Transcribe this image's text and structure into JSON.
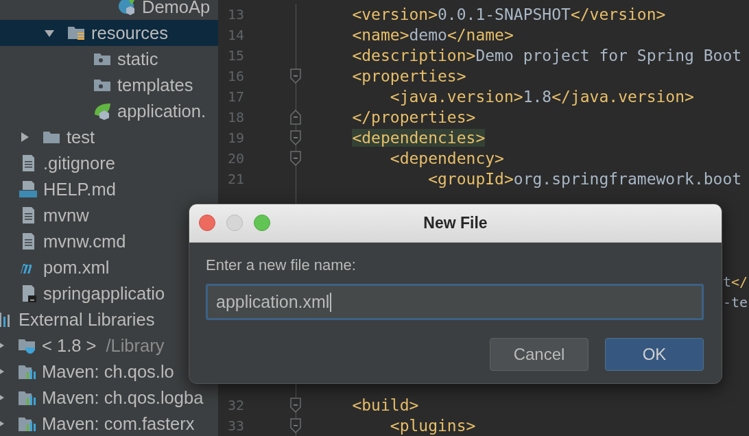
{
  "sidebar": {
    "tree": [
      {
        "children": [
          {
            "children": [
              {
                "children": [
                  {
                    "children": [
                      {
                        "children": [
                          {
                            "label": "DemoAp",
                            "kind": "spring-class",
                            "selected": false
                          }
                        ]
                      }
                    ]
                  },
                  {
                    "label": "resources",
                    "kind": "resources-folder",
                    "expanded": true,
                    "selected": true,
                    "children": [
                      {
                        "label": "static",
                        "kind": "web-folder",
                        "selected": false
                      },
                      {
                        "label": "templates",
                        "kind": "web-folder",
                        "selected": false
                      },
                      {
                        "label": "application.",
                        "kind": "spring-config",
                        "selected": false
                      }
                    ]
                  }
                ]
              },
              {
                "label": "test",
                "kind": "folder",
                "expanded": false,
                "selected": false
              }
            ]
          },
          {
            "label": ".gitignore",
            "kind": "text-file",
            "selected": false
          },
          {
            "label": "HELP.md",
            "kind": "markdown-file",
            "selected": false
          },
          {
            "label": "mvnw",
            "kind": "text-file",
            "selected": false
          },
          {
            "label": "mvnw.cmd",
            "kind": "text-file",
            "selected": false
          },
          {
            "label": "pom.xml",
            "kind": "maven-file",
            "selected": false
          },
          {
            "label": "springapplicatio",
            "kind": "script-file",
            "selected": false
          }
        ]
      },
      {
        "label": "External Libraries",
        "kind": "libraries",
        "selected": false,
        "children": [
          {
            "label": "< 1.8 >",
            "detail": "/Library",
            "kind": "jdk",
            "expanded": false,
            "selected": false
          },
          {
            "label": "Maven: ch.qos.lo",
            "kind": "maven-lib",
            "expanded": false,
            "selected": false
          },
          {
            "label": "Maven: ch.qos.logba",
            "kind": "maven-lib",
            "expanded": false,
            "selected": false
          },
          {
            "label": "Maven: com.fasterx",
            "kind": "maven-lib",
            "expanded": false,
            "selected": false
          }
        ]
      }
    ]
  },
  "editor": {
    "lines": [
      {
        "kind": "code",
        "number": "13",
        "tokens": [
          {
            "kind": "tag",
            "text": "    <version>"
          },
          {
            "kind": "text",
            "text": "0.0.1-SNAPSHOT"
          },
          {
            "kind": "tag",
            "text": "</version>"
          }
        ]
      },
      {
        "kind": "code",
        "number": "14",
        "tokens": [
          {
            "kind": "tag",
            "text": "    <name>"
          },
          {
            "kind": "text",
            "text": "demo"
          },
          {
            "kind": "tag",
            "text": "</name>"
          }
        ]
      },
      {
        "kind": "code",
        "number": "15",
        "tokens": [
          {
            "kind": "tag",
            "text": "    <description>"
          },
          {
            "kind": "text",
            "text": "Demo project for Spring Boot"
          }
        ]
      },
      {
        "kind": "code",
        "number": "16",
        "fold": {
          "kind": "start"
        },
        "tokens": [
          {
            "kind": "tag",
            "text": "    <properties>"
          }
        ]
      },
      {
        "kind": "code",
        "number": "17",
        "tokens": [
          {
            "kind": "tag",
            "text": "        <java.version>"
          },
          {
            "kind": "text",
            "text": "1.8"
          },
          {
            "kind": "tag",
            "text": "</java.version>"
          }
        ]
      },
      {
        "kind": "code",
        "number": "18",
        "fold": {
          "kind": "end"
        },
        "tokens": [
          {
            "kind": "tag",
            "text": "    </properties>"
          }
        ]
      },
      {
        "kind": "code",
        "number": "19",
        "fold": {
          "kind": "start"
        },
        "tokens": [
          {
            "kind": "tag-match",
            "text": "    <dependencies>"
          }
        ]
      },
      {
        "kind": "code",
        "number": "20",
        "fold": {
          "kind": "start"
        },
        "tokens": [
          {
            "kind": "tag",
            "text": "        <dependency>"
          }
        ]
      },
      {
        "kind": "code",
        "number": "21",
        "tokens": [
          {
            "kind": "tag",
            "text": "            <groupId>"
          },
          {
            "kind": "text",
            "text": "org.springframework.boot"
          }
        ]
      },
      {
        "kind": "hidden"
      },
      {
        "kind": "hidden"
      },
      {
        "kind": "hidden"
      },
      {
        "kind": "hidden"
      },
      {
        "kind": "fragment",
        "tokens": [
          {
            "kind": "text",
            "text": "t"
          },
          {
            "kind": "tag",
            "text": "</"
          }
        ]
      },
      {
        "kind": "fragment",
        "tokens": [
          {
            "kind": "text",
            "text": "-te"
          }
        ]
      },
      {
        "kind": "hidden"
      },
      {
        "kind": "hidden"
      },
      {
        "kind": "hidden"
      },
      {
        "kind": "hidden"
      },
      {
        "kind": "code",
        "number": "32",
        "fold": {
          "kind": "start"
        },
        "tokens": [
          {
            "kind": "tag",
            "text": "    <build>"
          }
        ]
      },
      {
        "kind": "code",
        "number": "33",
        "fold": {
          "kind": "start"
        },
        "tokens": [
          {
            "kind": "tag",
            "text": "        <plugins>"
          }
        ]
      }
    ]
  },
  "dialog": {
    "title": "New File",
    "prompt": "Enter a new file name:",
    "value": "application.xml",
    "buttons": [
      {
        "label": "Cancel",
        "kind": "secondary"
      },
      {
        "label": "OK",
        "kind": "default"
      }
    ]
  }
}
